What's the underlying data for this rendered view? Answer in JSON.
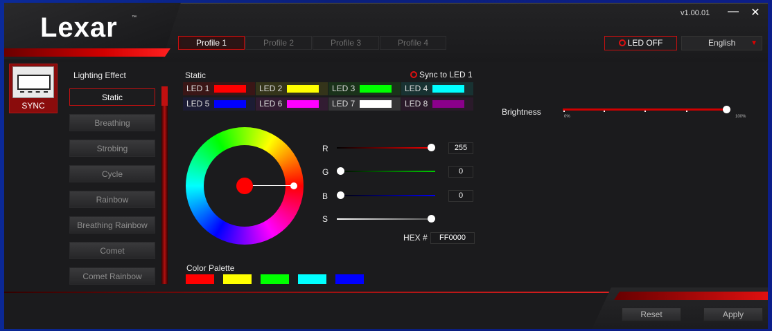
{
  "app": {
    "logo": "Lexar",
    "logo_tm": "™",
    "version": "v1.00.01"
  },
  "window_controls": {
    "minimize": "—",
    "close": "✕"
  },
  "profiles": [
    {
      "label": "Profile 1",
      "active": true
    },
    {
      "label": "Profile 2",
      "active": false
    },
    {
      "label": "Profile 3",
      "active": false
    },
    {
      "label": "Profile 4",
      "active": false
    }
  ],
  "led_off": {
    "label": "LED OFF"
  },
  "language": {
    "selected": "English",
    "arrow": "▼"
  },
  "sync": {
    "label": "SYNC",
    "icon": "ram-module-icon"
  },
  "lighting_effect": {
    "title": "Lighting Effect",
    "items": [
      "Static",
      "Breathing",
      "Strobing",
      "Cycle",
      "Rainbow",
      "Breathing Rainbow",
      "Comet",
      "Comet Rainbow"
    ],
    "selected": "Static"
  },
  "static_panel": {
    "title": "Static",
    "sync_to_led": "Sync to LED 1",
    "leds": [
      {
        "label": "LED 1",
        "color": "#ff0000",
        "bg": "#3a1616"
      },
      {
        "label": "LED 2",
        "color": "#ffff00",
        "bg": "#34341a"
      },
      {
        "label": "LED 3",
        "color": "#00ff00",
        "bg": "#1a321a"
      },
      {
        "label": "LED 4",
        "color": "#00ffff",
        "bg": "#183232"
      },
      {
        "label": "LED 5",
        "color": "#0000ff",
        "bg": "#1c1c34"
      },
      {
        "label": "LED 6",
        "color": "#ff00ff",
        "bg": "#321c32"
      },
      {
        "label": "LED 7",
        "color": "#ffffff",
        "bg": "#343436"
      },
      {
        "label": "LED 8",
        "color": "#8b008b",
        "bg": "#2a1a2a"
      }
    ],
    "sliders": {
      "r": {
        "label": "R",
        "value": "255",
        "level": 1.0
      },
      "g": {
        "label": "G",
        "value": "0",
        "level": 0.0
      },
      "b": {
        "label": "B",
        "value": "0",
        "level": 0.0
      },
      "s": {
        "label": "S",
        "level": 1.0
      }
    },
    "hex_label": "HEX #",
    "hex_value": "FF0000",
    "current_color": "#ff0000",
    "palette_title": "Color Palette",
    "palette": [
      "#ff0000",
      "#ffff00",
      "#00ff00",
      "#00ffff",
      "#0000ff"
    ]
  },
  "brightness": {
    "label": "Brightness",
    "level": 1.0,
    "min_label": "0%",
    "max_label": "100%"
  },
  "footer": {
    "reset": "Reset",
    "apply": "Apply"
  },
  "colors": {
    "accent": "#d00000",
    "background": "#1b1b1d"
  }
}
